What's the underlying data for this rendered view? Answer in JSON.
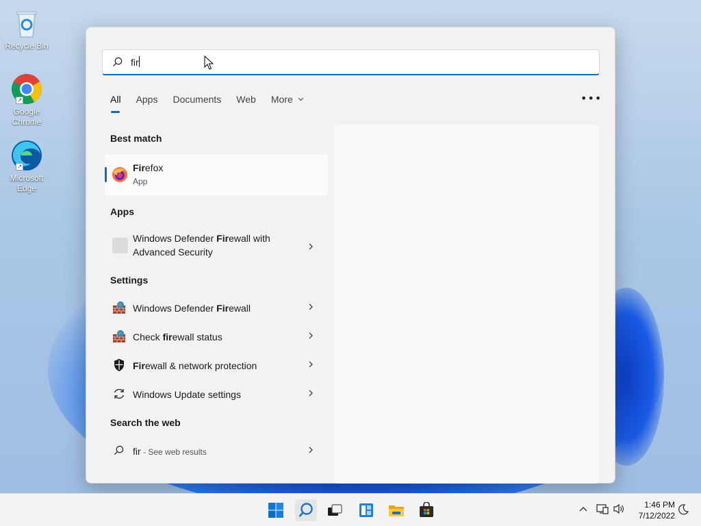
{
  "desktop": {
    "icons": [
      {
        "label_line1": "Recycle Bin",
        "label_line2": "",
        "icon": "recycle-bin-icon"
      },
      {
        "label_line1": "Google",
        "label_line2": "Chrome",
        "icon": "chrome-icon"
      },
      {
        "label_line1": "Microsoft",
        "label_line2": "Edge",
        "icon": "edge-icon"
      }
    ]
  },
  "search": {
    "query": "fir",
    "tabs": [
      {
        "label": "All",
        "active": true
      },
      {
        "label": "Apps"
      },
      {
        "label": "Documents"
      },
      {
        "label": "Web"
      },
      {
        "label": "More"
      }
    ],
    "more_options": "•••"
  },
  "results": {
    "best_match_heading": "Best match",
    "best_match": {
      "name_bold": "Fir",
      "name_rest": "efox",
      "subtitle": "App",
      "icon": "firefox-icon"
    },
    "apps_heading": "Apps",
    "apps": [
      {
        "pre": "Windows Defender ",
        "bold": "Fir",
        "post": "ewall with",
        "line2": "Advanced Security",
        "icon": "blank-app-icon"
      }
    ],
    "settings_heading": "Settings",
    "settings": [
      {
        "pre": "Windows Defender ",
        "bold": "Fir",
        "post": "ewall",
        "icon": "firewall-icon"
      },
      {
        "pre": "Check ",
        "bold": "fir",
        "post": "ewall status",
        "icon": "firewall-icon"
      },
      {
        "pre": "",
        "bold": "Fir",
        "post": "ewall & network protection",
        "icon": "shield-icon"
      },
      {
        "pre": "Windows Update settings",
        "bold": "",
        "post": "",
        "icon": "sync-icon"
      }
    ],
    "web_heading": "Search the web",
    "web": {
      "query": "fir",
      "suffix": " - See web results",
      "icon": "search-icon"
    }
  },
  "taskbar": {
    "apps": [
      {
        "name": "start",
        "icon": "windows-logo-icon"
      },
      {
        "name": "search",
        "icon": "search-icon",
        "active": true
      },
      {
        "name": "task-view",
        "icon": "task-view-icon"
      },
      {
        "name": "widgets",
        "icon": "widgets-icon"
      },
      {
        "name": "file-explorer",
        "icon": "folder-icon"
      },
      {
        "name": "store",
        "icon": "store-icon"
      }
    ],
    "clock": {
      "time": "1:46 PM",
      "date": "7/12/2022"
    }
  },
  "colors": {
    "accent": "#0f6cbd",
    "panel": "#f2f2f2",
    "taskbar": "#f3f3f3"
  }
}
